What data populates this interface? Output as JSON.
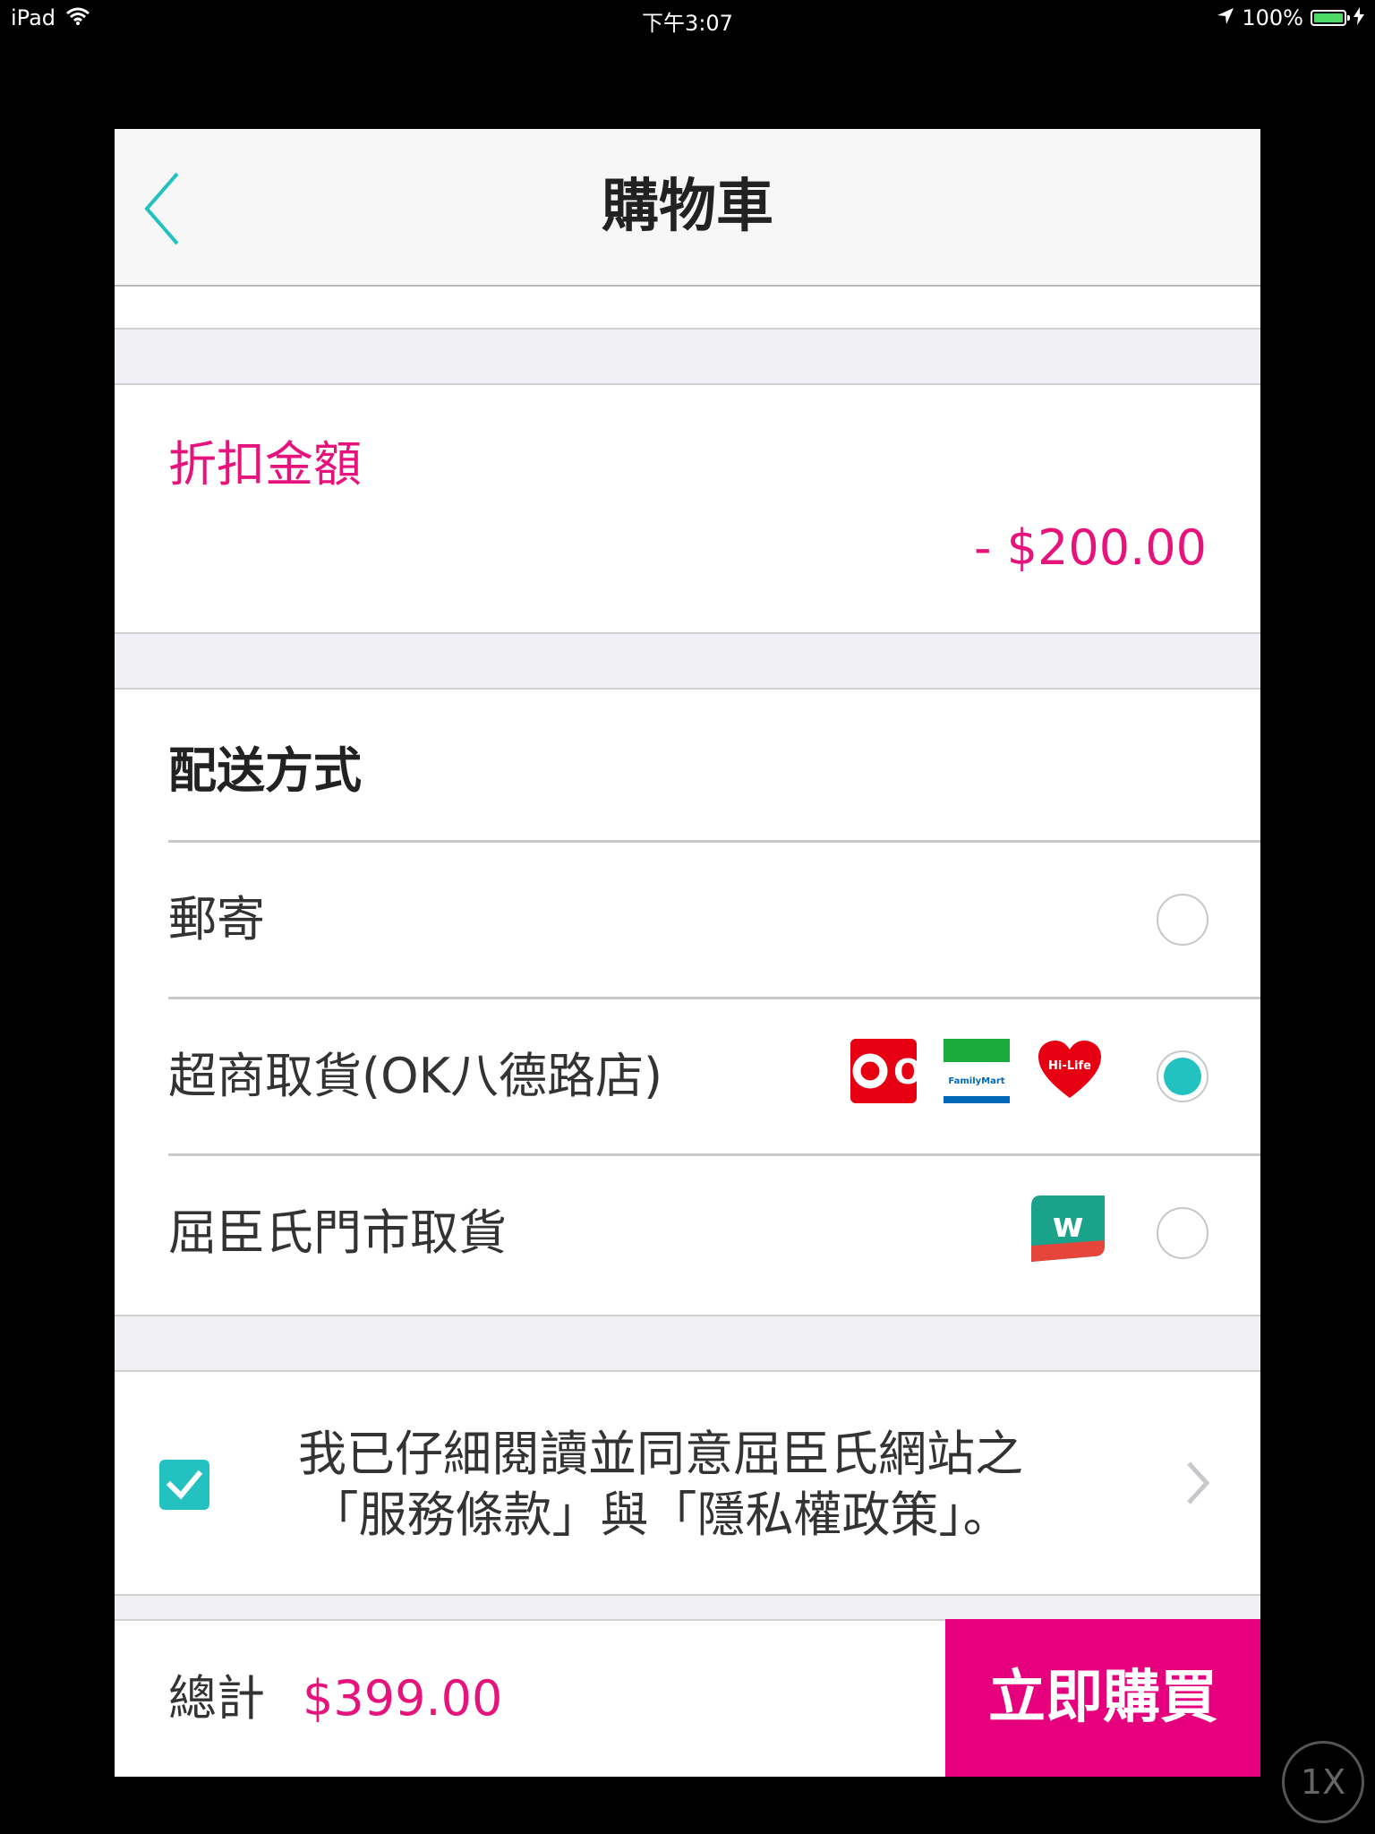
{
  "status_bar": {
    "device": "iPad",
    "time": "下午3:07",
    "battery": "100%",
    "battery_level": 1.0
  },
  "nav": {
    "title": "購物車"
  },
  "discount": {
    "label": "折扣金額",
    "value": "- $200.00"
  },
  "delivery": {
    "title": "配送方式",
    "options": [
      {
        "label": "郵寄",
        "selected": false
      },
      {
        "label": "超商取貨(OK八德路店)",
        "selected": true,
        "logos": [
          "ok-mart-logo",
          "familymart-logo",
          "hi-life-logo"
        ]
      },
      {
        "label": "屈臣氏門市取貨",
        "selected": false,
        "logos": [
          "watsons-logo"
        ]
      }
    ]
  },
  "logos": {
    "familymart": "FamilyMart",
    "hilife": "Hi-Life",
    "ok": "OK",
    "watsons": "w"
  },
  "agreement": {
    "checked": true,
    "line1": "我已仔細閱讀並同意屈臣氏網站之",
    "line2": "「服務條款」與「隱私權政策」。"
  },
  "footer": {
    "total_label": "總計",
    "total_value": "$399.00",
    "buy_label": "立即購買"
  },
  "zoom_badge": "1X",
  "colors": {
    "accent_teal": "#23c2c1",
    "accent_pink": "#e6137d",
    "buy_button": "#e6007e"
  }
}
